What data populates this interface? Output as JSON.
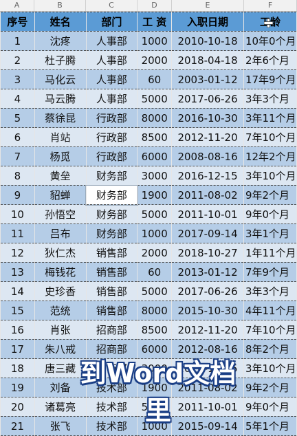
{
  "columns": [
    "A",
    "B",
    "C",
    "D",
    "E",
    "F"
  ],
  "headers": [
    "序号",
    "姓名",
    "部门",
    "工  资",
    "入职日期",
    "工龄"
  ],
  "rows": [
    [
      "1",
      "沈疼",
      "人事部",
      "1000",
      "2010-10-18",
      "10年0个月"
    ],
    [
      "2",
      "杜子腾",
      "人事部",
      "2000",
      "2018-04-18",
      "2年6个月"
    ],
    [
      "3",
      "马化云",
      "人事部",
      "60",
      "2003-01-12",
      "17年9个月"
    ],
    [
      "4",
      "马云腾",
      "人事部",
      "5000",
      "2017-06-26",
      "3年3个月"
    ],
    [
      "5",
      "蔡徐昆",
      "行政部",
      "8000",
      "2016-10-30",
      "3年11个月"
    ],
    [
      "6",
      "肖站",
      "行政部",
      "8500",
      "2012-11-20",
      "7年10个月"
    ],
    [
      "7",
      "杨觅",
      "行政部",
      "6000",
      "2008-08-16",
      "12年2个月"
    ],
    [
      "8",
      "黄垒",
      "财务部",
      "3000",
      "2016-12-15",
      "3年10个月"
    ],
    [
      "9",
      "貂蝉",
      "财务部",
      "1900",
      "2011-08-02",
      "9年2个月"
    ],
    [
      "10",
      "孙悟空",
      "财务部",
      "5000",
      "2011-10-01",
      "9年0个月"
    ],
    [
      "11",
      "吕布",
      "财务部",
      "1000",
      "2017-09-14",
      "3年1个月"
    ],
    [
      "12",
      "狄仁杰",
      "销售部",
      "2000",
      "2018-10-27",
      "1年11个月"
    ],
    [
      "13",
      "梅钱花",
      "销售部",
      "60",
      "2013-01-12",
      "7年9个月"
    ],
    [
      "14",
      "史珍香",
      "销售部",
      "5000",
      "2017-06-26",
      "3年3个月"
    ],
    [
      "15",
      "范统",
      "销售部",
      "8000",
      "2015-10-30",
      "4年11个月"
    ],
    [
      "16",
      "肖张",
      "招商部",
      "8500",
      "2012-11-20",
      "7年10个月"
    ],
    [
      "17",
      "朱八戒",
      "招商部",
      "6000",
      "2012-08-16",
      "8年2个月"
    ],
    [
      "18",
      "唐三藏",
      "招商部",
      "3000",
      "2016-12-15",
      "3年10个月"
    ],
    [
      "19",
      "刘备",
      "技术部",
      "1900",
      "2011-08-02",
      "9年2个月"
    ],
    [
      "20",
      "诸葛亮",
      "技术部",
      "5000",
      "2011-10-01",
      "9年0个月"
    ],
    [
      "21",
      "张飞",
      "技术部",
      "1000",
      "2015-09-14",
      "5年1个月"
    ]
  ],
  "selected_cell": {
    "row": 9,
    "col": 3
  },
  "subtitle": "到Word文档里",
  "colors": {
    "header": "#5b9bd5",
    "row_odd": "#b5cde7",
    "row_even": "#dde7f2",
    "subtitle_text": "#ffffff",
    "subtitle_outline": "#1b3f86"
  }
}
